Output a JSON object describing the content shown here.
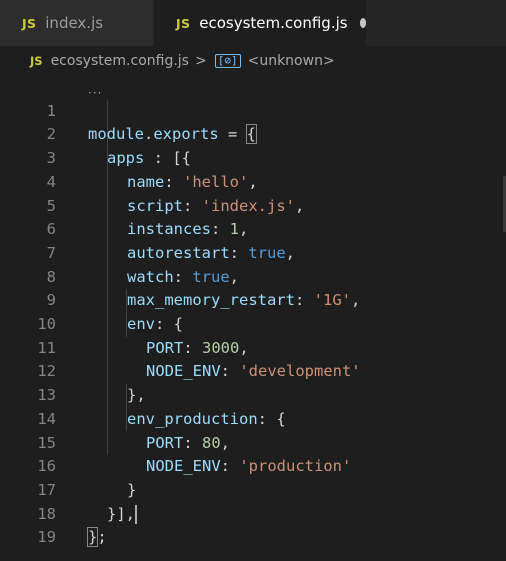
{
  "tabs": [
    {
      "icon": "JS",
      "label": "index.js",
      "active": false
    },
    {
      "icon": "JS",
      "label": "ecosystem.config.js",
      "active": true,
      "unsaved": true
    }
  ],
  "breadcrumb": {
    "file_icon": "JS",
    "file": "ecosystem.config.js",
    "separator": ">",
    "symbol_icon": "[⊘]",
    "symbol": "<unknown>"
  },
  "line_numbers": [
    "1",
    "2",
    "3",
    "4",
    "5",
    "6",
    "7",
    "8",
    "9",
    "10",
    "11",
    "12",
    "13",
    "14",
    "15",
    "16",
    "17",
    "18",
    "19"
  ],
  "code": {
    "l1": {
      "module": "module",
      "dot": ".",
      "exports": "exports",
      "eq": " = ",
      "brace": "{"
    },
    "l2": {
      "key": "apps",
      "punc": " : [{"
    },
    "l3": {
      "key": "name",
      "colon": ": ",
      "val": "'hello'",
      "end": ","
    },
    "l4": {
      "key": "script",
      "colon": ": ",
      "val": "'index.js'",
      "end": ","
    },
    "l5": {
      "key": "instances",
      "colon": ": ",
      "val": "1",
      "end": ","
    },
    "l6": {
      "key": "autorestart",
      "colon": ": ",
      "val": "true",
      "end": ","
    },
    "l7": {
      "key": "watch",
      "colon": ": ",
      "val": "true",
      "end": ","
    },
    "l8": {
      "key": "max_memory_restart",
      "colon": ": ",
      "val": "'1G'",
      "end": ","
    },
    "l9": {
      "key": "env",
      "punc": ": {"
    },
    "l10": {
      "key": "PORT",
      "colon": ": ",
      "val": "3000",
      "end": ","
    },
    "l11": {
      "key": "NODE_ENV",
      "colon": ": ",
      "val": "'development'"
    },
    "l12": {
      "punc": "},"
    },
    "l13": {
      "key": "env_production",
      "punc": ": {"
    },
    "l14": {
      "key": "PORT",
      "colon": ": ",
      "val": "80",
      "end": ","
    },
    "l15": {
      "key": "NODE_ENV",
      "colon": ": ",
      "val": "'production'"
    },
    "l16": {
      "punc": "}"
    },
    "l17": {
      "punc": "}],"
    },
    "l18": {
      "brace": "}",
      "end": ";"
    }
  },
  "colors": {
    "editor_bg": "#1e1e1e",
    "tabbar_bg": "#252526",
    "variable": "#9cdcfe",
    "string": "#ce9178",
    "number": "#b5cea8",
    "keyword": "#569cd6",
    "module": "#4ec9b0",
    "js_icon": "#cbcb41"
  }
}
